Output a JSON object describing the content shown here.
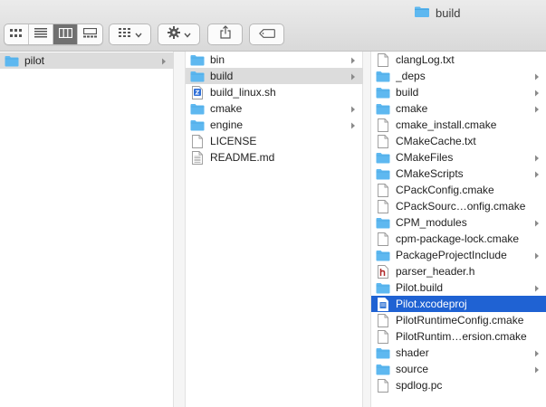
{
  "window": {
    "title": "build",
    "title_icon": "folder-icon"
  },
  "toolbar": {
    "view_modes": [
      "icon-view-icon",
      "list-view-icon",
      "column-view-icon",
      "gallery-view-icon"
    ],
    "active_view": "column-view-icon",
    "group_icon": "group-by-icon",
    "action_icon": "gear-icon",
    "share_icon": "share-icon",
    "tag_icon": "tag-icon"
  },
  "columns": {
    "col1": {
      "items": [
        {
          "label": "pilot",
          "icon": "folder-icon",
          "has_children": true,
          "selected": "gray"
        }
      ]
    },
    "col2": {
      "items": [
        {
          "label": "bin",
          "icon": "folder-icon",
          "has_children": true
        },
        {
          "label": "build",
          "icon": "folder-icon",
          "has_children": true,
          "selected": "gray"
        },
        {
          "label": "build_linux.sh",
          "icon": "shell-script-icon",
          "has_children": false
        },
        {
          "label": "cmake",
          "icon": "folder-icon",
          "has_children": true
        },
        {
          "label": "engine",
          "icon": "folder-icon",
          "has_children": true
        },
        {
          "label": "LICENSE",
          "icon": "document-icon",
          "has_children": false
        },
        {
          "label": "README.md",
          "icon": "text-document-icon",
          "has_children": false
        }
      ]
    },
    "col3": {
      "items": [
        {
          "label": "clangLog.txt",
          "icon": "document-icon",
          "has_children": false
        },
        {
          "label": "_deps",
          "icon": "folder-icon",
          "has_children": true
        },
        {
          "label": "build",
          "icon": "folder-icon",
          "has_children": true
        },
        {
          "label": "cmake",
          "icon": "folder-icon",
          "has_children": true
        },
        {
          "label": "cmake_install.cmake",
          "icon": "document-icon",
          "has_children": false
        },
        {
          "label": "CMakeCache.txt",
          "icon": "document-icon",
          "has_children": false
        },
        {
          "label": "CMakeFiles",
          "icon": "folder-icon",
          "has_children": true
        },
        {
          "label": "CMakeScripts",
          "icon": "folder-icon",
          "has_children": true
        },
        {
          "label": "CPackConfig.cmake",
          "icon": "document-icon",
          "has_children": false
        },
        {
          "label": "CPackSourc…onfig.cmake",
          "icon": "document-icon",
          "has_children": false
        },
        {
          "label": "CPM_modules",
          "icon": "folder-icon",
          "has_children": true
        },
        {
          "label": "cpm-package-lock.cmake",
          "icon": "document-icon",
          "has_children": false
        },
        {
          "label": "PackageProjectInclude",
          "icon": "folder-icon",
          "has_children": true
        },
        {
          "label": "parser_header.h",
          "icon": "header-file-icon",
          "has_children": false
        },
        {
          "label": "Pilot.build",
          "icon": "folder-icon",
          "has_children": true
        },
        {
          "label": "Pilot.xcodeproj",
          "icon": "xcodeproj-icon",
          "has_children": false,
          "selected": "blue"
        },
        {
          "label": "PilotRuntimeConfig.cmake",
          "icon": "document-icon",
          "has_children": false
        },
        {
          "label": "PilotRuntim…ersion.cmake",
          "icon": "document-icon",
          "has_children": false
        },
        {
          "label": "shader",
          "icon": "folder-icon",
          "has_children": true
        },
        {
          "label": "source",
          "icon": "folder-icon",
          "has_children": true
        },
        {
          "label": "spdlog.pc",
          "icon": "document-icon",
          "has_children": false
        }
      ]
    }
  },
  "colors": {
    "folder": "#5eb8f0",
    "selection_blue": "#1f62d3",
    "selection_gray": "#dcdcdc"
  }
}
